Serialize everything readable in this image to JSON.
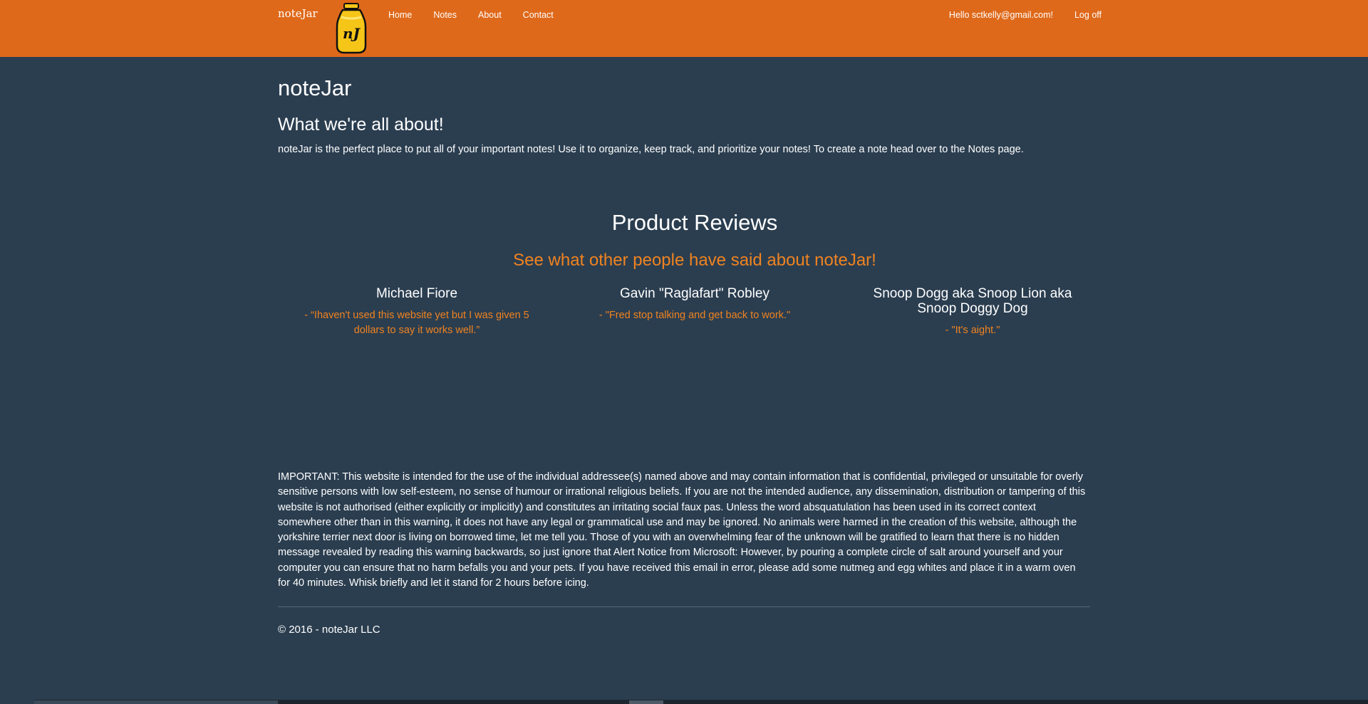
{
  "nav": {
    "brand": "noteJar",
    "links": [
      "Home",
      "Notes",
      "About",
      "Contact"
    ],
    "greeting": "Hello sctkelly@gmail.com!",
    "logoff": "Log off"
  },
  "logo": {
    "lettering": "nJ",
    "colors": {
      "jar": "#f5c518",
      "lid": "#f5c518",
      "outline": "#111111"
    }
  },
  "page": {
    "title": "noteJar",
    "about_heading": "What we're all about!",
    "about_text": "noteJar is the perfect place to put all of your important notes! Use it to organize, keep track, and prioritize your notes! To create a note head over to the Notes page."
  },
  "reviews": {
    "heading": "Product Reviews",
    "subheading": "See what other people have said about noteJar!",
    "items": [
      {
        "name": "Michael Fiore",
        "quote": "- “Ihaven't used this website yet but I was given 5 dollars to say it works well.”"
      },
      {
        "name": "Gavin \"Raglafart\" Robley",
        "quote": "- \"Fred stop talking and get back to work.\""
      },
      {
        "name": "Snoop Dogg aka Snoop Lion aka Snoop Doggy Dog",
        "quote": "- \"It's aight.\""
      }
    ]
  },
  "disclaimer": "IMPORTANT: This website is intended for the use of the individual addressee(s) named above and may contain information that is confidential, privileged or unsuitable for overly sensitive persons with low self-esteem, no sense of humour or irrational religious beliefs. If you are not the intended audience, any dissemination, distribution or tampering of this website is not authorised (either explicitly or implicitly) and constitutes an irritating social faux pas. Unless the word absquatulation has been used in its correct context somewhere other than in this warning, it does not have any legal or grammatical use and may be ignored. No animals were harmed in the creation of this website, although the yorkshire terrier next door is living on borrowed time, let me tell you. Those of you with an overwhelming fear of the unknown will be gratified to learn that there is no hidden message revealed by reading this warning backwards, so just ignore that Alert Notice from Microsoft: However, by pouring a complete circle of salt around yourself and your computer you can ensure that no harm befalls you and your pets. If you have received this email in error, please add some nutmeg and egg whites and place it in a warm oven for 40 minutes. Whisk briefly and let it stand for 2 hours before icing.",
  "footer": "© 2016 - noteJar LLC",
  "colors": {
    "navbar": "#df691a",
    "background": "#2b3e50",
    "accent": "#f0831f"
  }
}
